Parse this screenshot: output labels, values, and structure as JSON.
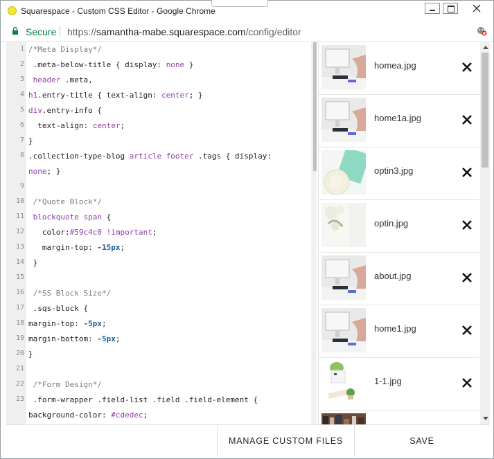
{
  "window": {
    "title": "Squarespace - Custom CSS Editor - Google Chrome"
  },
  "address_bar": {
    "secure_label": "Secure",
    "url_scheme": "https://",
    "url_host": "samantha-mabe.squarespace.com",
    "url_path": "/config/editor"
  },
  "editor": {
    "lines": [
      {
        "n": "1",
        "parts": [
          [
            "c",
            "/*Meta Display*/"
          ]
        ]
      },
      {
        "n": "2",
        "parts": [
          [
            "p",
            " .meta-below-title { display: "
          ],
          [
            "v",
            "none"
          ],
          [
            "p",
            " }"
          ]
        ]
      },
      {
        "n": "3",
        "parts": [
          [
            "t",
            " header"
          ],
          [
            "p",
            " .meta,"
          ]
        ]
      },
      {
        "n": "4",
        "parts": [
          [
            "t",
            "h1"
          ],
          [
            "p",
            ".entry-title { text-align: "
          ],
          [
            "v",
            "center"
          ],
          [
            "p",
            "; }"
          ]
        ]
      },
      {
        "n": "5",
        "parts": [
          [
            "t",
            "div"
          ],
          [
            "p",
            ".entry-info {"
          ]
        ]
      },
      {
        "n": "6",
        "parts": [
          [
            "p",
            "  text-align: "
          ],
          [
            "v",
            "center"
          ],
          [
            "p",
            ";"
          ]
        ]
      },
      {
        "n": "7",
        "parts": [
          [
            "p",
            "}"
          ]
        ]
      },
      {
        "n": "8",
        "parts": [
          [
            "p",
            ".collection-type-blog "
          ],
          [
            "t",
            "article"
          ],
          [
            "p",
            " "
          ],
          [
            "t",
            "footer"
          ],
          [
            "p",
            " .tags { display:"
          ]
        ]
      },
      {
        "n": "",
        "parts": [
          [
            "v",
            "none"
          ],
          [
            "p",
            "; }"
          ]
        ]
      },
      {
        "n": "9",
        "parts": []
      },
      {
        "n": "10",
        "parts": [
          [
            "c",
            " /*Quote Block*/"
          ]
        ]
      },
      {
        "n": "11",
        "parts": [
          [
            "t",
            " blockquote"
          ],
          [
            "p",
            " "
          ],
          [
            "t",
            "span"
          ],
          [
            "p",
            " {"
          ]
        ]
      },
      {
        "n": "12",
        "parts": [
          [
            "p",
            "   color:"
          ],
          [
            "v",
            "#59c4c0"
          ],
          [
            "p",
            " "
          ],
          [
            "v",
            "!important"
          ],
          [
            "p",
            ";"
          ]
        ]
      },
      {
        "n": "13",
        "parts": [
          [
            "p",
            "   margin-top: "
          ],
          [
            "n",
            "-15px"
          ],
          [
            "p",
            ";"
          ]
        ]
      },
      {
        "n": "14",
        "parts": [
          [
            "p",
            " }"
          ]
        ]
      },
      {
        "n": "15",
        "parts": []
      },
      {
        "n": "16",
        "parts": [
          [
            "c",
            " /*SS Block Size*/"
          ]
        ]
      },
      {
        "n": "17",
        "parts": [
          [
            "p",
            " .sqs-block {"
          ]
        ]
      },
      {
        "n": "18",
        "parts": [
          [
            "p",
            "margin-top: "
          ],
          [
            "n",
            "-5px"
          ],
          [
            "p",
            ";"
          ]
        ]
      },
      {
        "n": "19",
        "parts": [
          [
            "p",
            "margin-bottom: "
          ],
          [
            "n",
            "-5px"
          ],
          [
            "p",
            ";"
          ]
        ]
      },
      {
        "n": "20",
        "parts": [
          [
            "p",
            "}"
          ]
        ]
      },
      {
        "n": "21",
        "parts": []
      },
      {
        "n": "22",
        "parts": [
          [
            "c",
            " /*Form Design*/"
          ]
        ]
      },
      {
        "n": "23",
        "parts": [
          [
            "p",
            " .form-wrapper .field-list .field .field-element {"
          ]
        ]
      },
      {
        "n": "",
        "parts": [
          [
            "p",
            "background-color: "
          ],
          [
            "v",
            "#cdedec"
          ],
          [
            "p",
            ";"
          ]
        ]
      }
    ]
  },
  "files": {
    "items": [
      {
        "name": "homea.jpg",
        "thumb": "desk"
      },
      {
        "name": "home1a.jpg",
        "thumb": "desk"
      },
      {
        "name": "optin3.jpg",
        "thumb": "mint"
      },
      {
        "name": "optin.jpg",
        "thumb": "flowers"
      },
      {
        "name": "about.jpg",
        "thumb": "desk"
      },
      {
        "name": "home1.jpg",
        "thumb": "desk"
      },
      {
        "name": "1-1.jpg",
        "thumb": "plant"
      },
      {
        "name": "",
        "thumb": "books"
      }
    ],
    "remove_icon": "close-x-icon"
  },
  "footer": {
    "manage_label": "MANAGE CUSTOM FILES",
    "save_label": "SAVE"
  },
  "colors": {
    "secure_green": "#0b8043",
    "comment": "#7c7c7c",
    "keyword_purple": "#8e3ea7",
    "number_blue": "#1b5a94"
  }
}
